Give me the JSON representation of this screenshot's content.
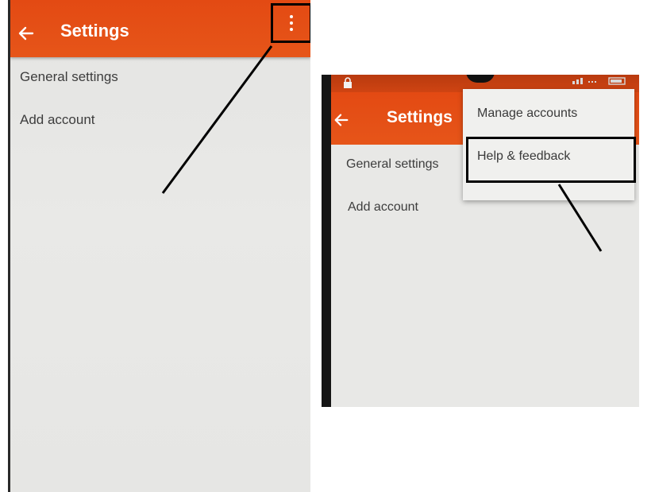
{
  "left_screen": {
    "appbar": {
      "title": "Settings",
      "back_icon": "arrow-left-icon",
      "menu_icon": "more-vert-icon"
    },
    "items": [
      "General settings",
      "Add account"
    ]
  },
  "right_screen": {
    "appbar": {
      "title": "Settings",
      "back_icon": "arrow-left-icon"
    },
    "items": [
      "General settings",
      "Add account"
    ],
    "overflow_menu": [
      "Manage accounts",
      "Help & feedback"
    ],
    "highlighted_menu_item": "Help & feedback"
  },
  "colors": {
    "appbar": "#e34a13",
    "screen_bg": "#e6e6e4",
    "text": "#3d3d3d",
    "annotation": "#000000"
  }
}
